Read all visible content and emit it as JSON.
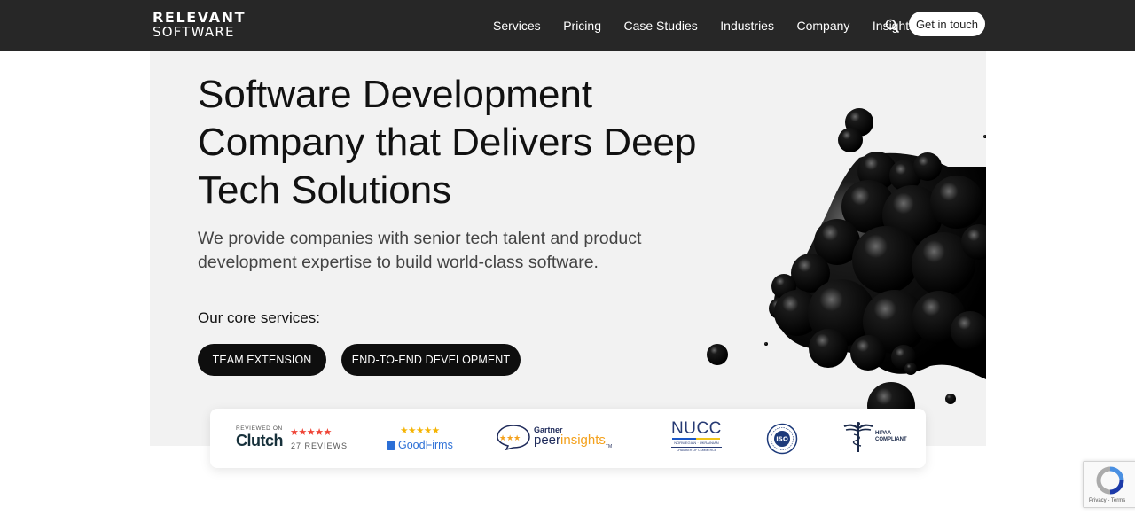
{
  "header": {
    "logo_top": "RELEVANT",
    "logo_bottom": "SOFTWARE",
    "nav": [
      "Services",
      "Pricing",
      "Case Studies",
      "Industries",
      "Company",
      "Insights"
    ],
    "search_icon": "search-icon",
    "cta_label": "Get in touch"
  },
  "hero": {
    "title_lines": [
      "Software Development",
      "Company that Delivers Deep",
      "Tech Solutions"
    ],
    "subtitle_lines": [
      "We provide companies with senior tech talent and product",
      "development expertise to build world-class software."
    ],
    "core_label": "Our core services:",
    "buttons": [
      "TEAM EXTENSION",
      "END-TO-END DEVELOPMENT"
    ]
  },
  "badges": {
    "clutch": {
      "reviewed_on": "REVIEWED ON",
      "brand": "Clutch",
      "stars": "★★★★★",
      "reviews": "27 REVIEWS"
    },
    "goodfirms": {
      "stars": "★★★★★",
      "brand": "GoodFirms"
    },
    "gartner": {
      "stars": "★★★",
      "brand_small": "Gartner",
      "brand_peer": "peer",
      "brand_insights": "insights",
      "tm": "TM"
    },
    "nucc": {
      "brand": "NUCC",
      "line1": "NORWEGIAN · UKRAINIAN",
      "line2": "CHAMBER OF COMMERCE"
    },
    "iso": {
      "label": "ISO"
    },
    "hipaa": {
      "line1": "HIPAA",
      "line2": "COMPLIANT"
    }
  },
  "recaptcha": {
    "links": "Privacy - Terms"
  },
  "colors": {
    "header_bg": "#272727",
    "hero_bg": "#f2f2f2",
    "pill_bg": "#0e0e0e",
    "clutch_star": "#ef4335",
    "goodfirms_blue": "#2b6fd6"
  }
}
